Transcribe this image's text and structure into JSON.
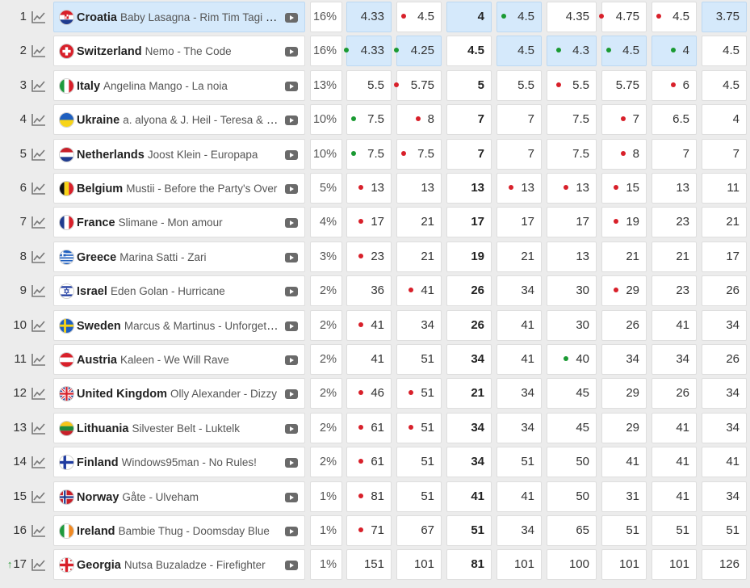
{
  "columns_count": 8,
  "colors": {
    "highlight": "#d5e9fb",
    "dot_red": "#d8202a",
    "dot_green": "#1a9a32",
    "trend_up": "#2a9a3a"
  },
  "rows": [
    {
      "rank": "1",
      "rank_trend": "",
      "country": "Croatia",
      "artist_song": "Baby Lasagna - Rim Tim Tagi Dim",
      "flag": "croatia",
      "pct": "16%",
      "highlight": true,
      "odds": [
        {
          "v": "4.33",
          "dot": "",
          "hl": true
        },
        {
          "v": "4.5",
          "dot": "red",
          "hl": false
        },
        {
          "v": "4",
          "dot": "",
          "hl": true
        },
        {
          "v": "4.5",
          "dot": "green",
          "hl": true
        },
        {
          "v": "4.35",
          "dot": "",
          "hl": false
        },
        {
          "v": "4.75",
          "dot": "red",
          "hl": false
        },
        {
          "v": "4.5",
          "dot": "red",
          "hl": false
        },
        {
          "v": "3.75",
          "dot": "",
          "hl": true
        }
      ]
    },
    {
      "rank": "2",
      "rank_trend": "",
      "country": "Switzerland",
      "artist_song": "Nemo - The Code",
      "flag": "switzerland",
      "pct": "16%",
      "highlight": false,
      "odds": [
        {
          "v": "4.33",
          "dot": "green",
          "hl": true
        },
        {
          "v": "4.25",
          "dot": "green",
          "hl": true
        },
        {
          "v": "4.5",
          "dot": "",
          "hl": false
        },
        {
          "v": "4.5",
          "dot": "",
          "hl": true
        },
        {
          "v": "4.3",
          "dot": "green",
          "hl": true
        },
        {
          "v": "4.5",
          "dot": "green",
          "hl": true
        },
        {
          "v": "4",
          "dot": "green",
          "hl": true
        },
        {
          "v": "4.5",
          "dot": "",
          "hl": false
        }
      ]
    },
    {
      "rank": "3",
      "rank_trend": "",
      "country": "Italy",
      "artist_song": "Angelina Mango - La noia",
      "flag": "italy",
      "pct": "13%",
      "highlight": false,
      "odds": [
        {
          "v": "5.5",
          "dot": "",
          "hl": false
        },
        {
          "v": "5.75",
          "dot": "red",
          "hl": false
        },
        {
          "v": "5",
          "dot": "",
          "hl": false
        },
        {
          "v": "5.5",
          "dot": "",
          "hl": false
        },
        {
          "v": "5.5",
          "dot": "red",
          "hl": false
        },
        {
          "v": "5.75",
          "dot": "",
          "hl": false
        },
        {
          "v": "6",
          "dot": "red",
          "hl": false
        },
        {
          "v": "4.5",
          "dot": "",
          "hl": false
        }
      ]
    },
    {
      "rank": "4",
      "rank_trend": "",
      "country": "Ukraine",
      "artist_song": "a. alyona & J. Heil - Teresa & Maria",
      "flag": "ukraine",
      "pct": "10%",
      "highlight": false,
      "odds": [
        {
          "v": "7.5",
          "dot": "green",
          "hl": false
        },
        {
          "v": "8",
          "dot": "red",
          "hl": false
        },
        {
          "v": "7",
          "dot": "",
          "hl": false
        },
        {
          "v": "7",
          "dot": "",
          "hl": false
        },
        {
          "v": "7.5",
          "dot": "",
          "hl": false
        },
        {
          "v": "7",
          "dot": "red",
          "hl": false
        },
        {
          "v": "6.5",
          "dot": "",
          "hl": false
        },
        {
          "v": "4",
          "dot": "",
          "hl": false
        }
      ]
    },
    {
      "rank": "5",
      "rank_trend": "",
      "country": "Netherlands",
      "artist_song": "Joost Klein - Europapa",
      "flag": "netherlands",
      "pct": "10%",
      "highlight": false,
      "odds": [
        {
          "v": "7.5",
          "dot": "green",
          "hl": false
        },
        {
          "v": "7.5",
          "dot": "red",
          "hl": false
        },
        {
          "v": "7",
          "dot": "",
          "hl": false
        },
        {
          "v": "7",
          "dot": "",
          "hl": false
        },
        {
          "v": "7.5",
          "dot": "",
          "hl": false
        },
        {
          "v": "8",
          "dot": "red",
          "hl": false
        },
        {
          "v": "7",
          "dot": "",
          "hl": false
        },
        {
          "v": "7",
          "dot": "",
          "hl": false
        }
      ]
    },
    {
      "rank": "6",
      "rank_trend": "",
      "country": "Belgium",
      "artist_song": "Mustii - Before the Party's Over",
      "flag": "belgium",
      "pct": "5%",
      "highlight": false,
      "odds": [
        {
          "v": "13",
          "dot": "red",
          "hl": false
        },
        {
          "v": "13",
          "dot": "",
          "hl": false
        },
        {
          "v": "13",
          "dot": "",
          "hl": false
        },
        {
          "v": "13",
          "dot": "red",
          "hl": false
        },
        {
          "v": "13",
          "dot": "red",
          "hl": false
        },
        {
          "v": "15",
          "dot": "red",
          "hl": false
        },
        {
          "v": "13",
          "dot": "",
          "hl": false
        },
        {
          "v": "11",
          "dot": "",
          "hl": false
        }
      ]
    },
    {
      "rank": "7",
      "rank_trend": "",
      "country": "France",
      "artist_song": "Slimane - Mon amour",
      "flag": "france",
      "pct": "4%",
      "highlight": false,
      "odds": [
        {
          "v": "17",
          "dot": "red",
          "hl": false
        },
        {
          "v": "21",
          "dot": "",
          "hl": false
        },
        {
          "v": "17",
          "dot": "",
          "hl": false
        },
        {
          "v": "17",
          "dot": "",
          "hl": false
        },
        {
          "v": "17",
          "dot": "",
          "hl": false
        },
        {
          "v": "19",
          "dot": "red",
          "hl": false
        },
        {
          "v": "23",
          "dot": "",
          "hl": false
        },
        {
          "v": "21",
          "dot": "",
          "hl": false
        }
      ]
    },
    {
      "rank": "8",
      "rank_trend": "",
      "country": "Greece",
      "artist_song": "Marina Satti - Zari",
      "flag": "greece",
      "pct": "3%",
      "highlight": false,
      "odds": [
        {
          "v": "23",
          "dot": "red",
          "hl": false
        },
        {
          "v": "21",
          "dot": "",
          "hl": false
        },
        {
          "v": "19",
          "dot": "",
          "hl": false
        },
        {
          "v": "21",
          "dot": "",
          "hl": false
        },
        {
          "v": "13",
          "dot": "",
          "hl": false
        },
        {
          "v": "21",
          "dot": "",
          "hl": false
        },
        {
          "v": "21",
          "dot": "",
          "hl": false
        },
        {
          "v": "17",
          "dot": "",
          "hl": false
        }
      ]
    },
    {
      "rank": "9",
      "rank_trend": "",
      "country": "Israel",
      "artist_song": "Eden Golan - Hurricane",
      "flag": "israel",
      "pct": "2%",
      "highlight": false,
      "odds": [
        {
          "v": "36",
          "dot": "",
          "hl": false
        },
        {
          "v": "41",
          "dot": "red",
          "hl": false
        },
        {
          "v": "26",
          "dot": "",
          "hl": false
        },
        {
          "v": "34",
          "dot": "",
          "hl": false
        },
        {
          "v": "30",
          "dot": "",
          "hl": false
        },
        {
          "v": "29",
          "dot": "red",
          "hl": false
        },
        {
          "v": "23",
          "dot": "",
          "hl": false
        },
        {
          "v": "26",
          "dot": "",
          "hl": false
        }
      ]
    },
    {
      "rank": "10",
      "rank_trend": "",
      "country": "Sweden",
      "artist_song": "Marcus & Martinus - Unforgettable",
      "flag": "sweden",
      "pct": "2%",
      "highlight": false,
      "odds": [
        {
          "v": "41",
          "dot": "red",
          "hl": false
        },
        {
          "v": "34",
          "dot": "",
          "hl": false
        },
        {
          "v": "26",
          "dot": "",
          "hl": false
        },
        {
          "v": "41",
          "dot": "",
          "hl": false
        },
        {
          "v": "30",
          "dot": "",
          "hl": false
        },
        {
          "v": "26",
          "dot": "",
          "hl": false
        },
        {
          "v": "41",
          "dot": "",
          "hl": false
        },
        {
          "v": "34",
          "dot": "",
          "hl": false
        }
      ]
    },
    {
      "rank": "11",
      "rank_trend": "",
      "country": "Austria",
      "artist_song": "Kaleen - We Will Rave",
      "flag": "austria",
      "pct": "2%",
      "highlight": false,
      "odds": [
        {
          "v": "41",
          "dot": "",
          "hl": false
        },
        {
          "v": "51",
          "dot": "",
          "hl": false
        },
        {
          "v": "34",
          "dot": "",
          "hl": false
        },
        {
          "v": "41",
          "dot": "",
          "hl": false
        },
        {
          "v": "40",
          "dot": "green",
          "hl": false
        },
        {
          "v": "34",
          "dot": "",
          "hl": false
        },
        {
          "v": "34",
          "dot": "",
          "hl": false
        },
        {
          "v": "26",
          "dot": "",
          "hl": false
        }
      ]
    },
    {
      "rank": "12",
      "rank_trend": "",
      "country": "United Kingdom",
      "artist_song": "Olly Alexander - Dizzy",
      "flag": "uk",
      "pct": "2%",
      "highlight": false,
      "odds": [
        {
          "v": "46",
          "dot": "red",
          "hl": false
        },
        {
          "v": "51",
          "dot": "red",
          "hl": false
        },
        {
          "v": "21",
          "dot": "",
          "hl": false
        },
        {
          "v": "34",
          "dot": "",
          "hl": false
        },
        {
          "v": "45",
          "dot": "",
          "hl": false
        },
        {
          "v": "29",
          "dot": "",
          "hl": false
        },
        {
          "v": "26",
          "dot": "",
          "hl": false
        },
        {
          "v": "34",
          "dot": "",
          "hl": false
        }
      ]
    },
    {
      "rank": "13",
      "rank_trend": "",
      "country": "Lithuania",
      "artist_song": "Silvester Belt - Luktelk",
      "flag": "lithuania",
      "pct": "2%",
      "highlight": false,
      "odds": [
        {
          "v": "61",
          "dot": "red",
          "hl": false
        },
        {
          "v": "51",
          "dot": "red",
          "hl": false
        },
        {
          "v": "34",
          "dot": "",
          "hl": false
        },
        {
          "v": "34",
          "dot": "",
          "hl": false
        },
        {
          "v": "45",
          "dot": "",
          "hl": false
        },
        {
          "v": "29",
          "dot": "",
          "hl": false
        },
        {
          "v": "41",
          "dot": "",
          "hl": false
        },
        {
          "v": "34",
          "dot": "",
          "hl": false
        }
      ]
    },
    {
      "rank": "14",
      "rank_trend": "",
      "country": "Finland",
      "artist_song": "Windows95man - No Rules!",
      "flag": "finland",
      "pct": "2%",
      "highlight": false,
      "odds": [
        {
          "v": "61",
          "dot": "red",
          "hl": false
        },
        {
          "v": "51",
          "dot": "",
          "hl": false
        },
        {
          "v": "34",
          "dot": "",
          "hl": false
        },
        {
          "v": "51",
          "dot": "",
          "hl": false
        },
        {
          "v": "50",
          "dot": "",
          "hl": false
        },
        {
          "v": "41",
          "dot": "",
          "hl": false
        },
        {
          "v": "41",
          "dot": "",
          "hl": false
        },
        {
          "v": "41",
          "dot": "",
          "hl": false
        }
      ]
    },
    {
      "rank": "15",
      "rank_trend": "",
      "country": "Norway",
      "artist_song": "Gåte - Ulveham",
      "flag": "norway",
      "pct": "1%",
      "highlight": false,
      "odds": [
        {
          "v": "81",
          "dot": "red",
          "hl": false
        },
        {
          "v": "51",
          "dot": "",
          "hl": false
        },
        {
          "v": "41",
          "dot": "",
          "hl": false
        },
        {
          "v": "41",
          "dot": "",
          "hl": false
        },
        {
          "v": "50",
          "dot": "",
          "hl": false
        },
        {
          "v": "31",
          "dot": "",
          "hl": false
        },
        {
          "v": "41",
          "dot": "",
          "hl": false
        },
        {
          "v": "34",
          "dot": "",
          "hl": false
        }
      ]
    },
    {
      "rank": "16",
      "rank_trend": "",
      "country": "Ireland",
      "artist_song": "Bambie Thug - Doomsday Blue",
      "flag": "ireland",
      "pct": "1%",
      "highlight": false,
      "odds": [
        {
          "v": "71",
          "dot": "red",
          "hl": false
        },
        {
          "v": "67",
          "dot": "",
          "hl": false
        },
        {
          "v": "51",
          "dot": "",
          "hl": false
        },
        {
          "v": "34",
          "dot": "",
          "hl": false
        },
        {
          "v": "65",
          "dot": "",
          "hl": false
        },
        {
          "v": "51",
          "dot": "",
          "hl": false
        },
        {
          "v": "51",
          "dot": "",
          "hl": false
        },
        {
          "v": "51",
          "dot": "",
          "hl": false
        }
      ]
    },
    {
      "rank": "17",
      "rank_trend": "up",
      "country": "Georgia",
      "artist_song": "Nutsa Buzaladze - Firefighter",
      "flag": "georgia",
      "pct": "1%",
      "highlight": false,
      "odds": [
        {
          "v": "151",
          "dot": "",
          "hl": false
        },
        {
          "v": "101",
          "dot": "",
          "hl": false
        },
        {
          "v": "81",
          "dot": "",
          "hl": false
        },
        {
          "v": "101",
          "dot": "",
          "hl": false
        },
        {
          "v": "100",
          "dot": "",
          "hl": false
        },
        {
          "v": "101",
          "dot": "",
          "hl": false
        },
        {
          "v": "101",
          "dot": "",
          "hl": false
        },
        {
          "v": "126",
          "dot": "",
          "hl": false
        }
      ]
    }
  ]
}
